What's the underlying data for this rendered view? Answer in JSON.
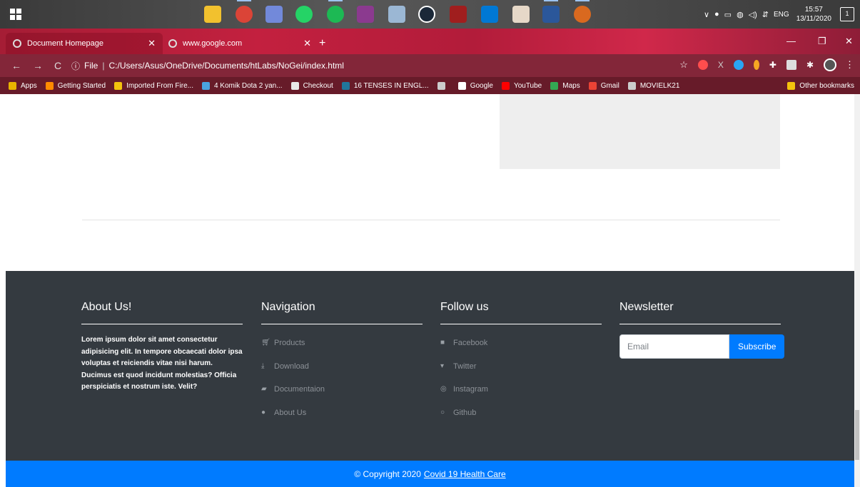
{
  "taskbar": {
    "time": "15:57",
    "date": "13/11/2020",
    "language": "ENG",
    "notification_count": "1"
  },
  "browser": {
    "tabs": [
      {
        "label": "Document Homepage"
      },
      {
        "label": "www.google.com"
      }
    ],
    "address": {
      "scheme_label": "File",
      "url": "C:/Users/Asus/OneDrive/Documents/htLabs/NoGei/index.html"
    },
    "bookmarks": [
      {
        "label": "Apps",
        "icon": "apps-grid-icon",
        "color": "#e8b400"
      },
      {
        "label": "Getting Started",
        "icon": "firefox-icon",
        "color": "#ff8a00"
      },
      {
        "label": "Imported From Fire...",
        "icon": "folder-icon",
        "color": "#f4c20d"
      },
      {
        "label": "4 Komik Dota 2 yan...",
        "icon": "site-icon",
        "color": "#4aa3df"
      },
      {
        "label": "Checkout",
        "icon": "site-icon",
        "color": "#e8e8e8"
      },
      {
        "label": "16 TENSES IN ENGL...",
        "icon": "wordpress-icon",
        "color": "#21759b"
      },
      {
        "label": "",
        "icon": "globe-icon",
        "color": "#ccc"
      },
      {
        "label": "Google",
        "icon": "google-icon",
        "color": "#ffffff"
      },
      {
        "label": "YouTube",
        "icon": "youtube-icon",
        "color": "#ff0000"
      },
      {
        "label": "Maps",
        "icon": "maps-icon",
        "color": "#34a853"
      },
      {
        "label": "Gmail",
        "icon": "gmail-icon",
        "color": "#ea4335"
      },
      {
        "label": "MOVIELK21",
        "icon": "globe-icon",
        "color": "#ccc"
      }
    ],
    "other_bookmarks": "Other bookmarks"
  },
  "footer": {
    "about": {
      "title": "About Us!",
      "text": "Lorem ipsum dolor sit amet consectetur adipisicing elit. In tempore obcaecati dolor ipsa voluptas et reiciendis vitae nisi harum. Ducimus est quod incidunt molestias? Officia perspiciatis et nostrum iste. Velit?"
    },
    "navigation": {
      "title": "Navigation",
      "items": [
        {
          "label": "Products",
          "icon": "cart-icon"
        },
        {
          "label": "Download",
          "icon": "download-icon"
        },
        {
          "label": "Documentaion",
          "icon": "book-icon"
        },
        {
          "label": "About Us",
          "icon": "info-icon"
        }
      ]
    },
    "follow": {
      "title": "Follow us",
      "items": [
        {
          "label": "Facebook",
          "icon": "facebook-icon"
        },
        {
          "label": "Twitter",
          "icon": "twitter-icon"
        },
        {
          "label": "Instagram",
          "icon": "instagram-icon"
        },
        {
          "label": "Github",
          "icon": "github-icon"
        }
      ]
    },
    "newsletter": {
      "title": "Newsletter",
      "placeholder": "Email",
      "button": "Subscribe"
    },
    "copyright": {
      "prefix": "© Copyright 2020",
      "link": "Covid 19 Health Care"
    }
  },
  "colors": {
    "footer_bg": "#343a40",
    "primary": "#007bff"
  }
}
